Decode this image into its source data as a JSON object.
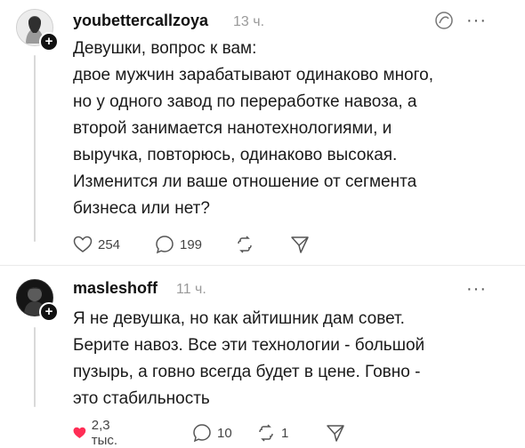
{
  "posts": [
    {
      "username": "youbettercallzoya",
      "time": "13 ч.",
      "text": "Девушки, вопрос к вам:\nдвое мужчин зарабатывают одинаково много,\nно у одного завод по переработке навоза, а\nвторой занимается нанотехнологиями, и\nвыручка, повторюсь, одинаково высокая.\nИзменится ли ваше отношение от сегмента\nбизнеса или нет?",
      "likes": "254",
      "replies": "199",
      "reposts": "",
      "liked": false
    },
    {
      "username": "masleshoff",
      "time": "11 ч.",
      "text": "Я не девушка, но как айтишник дам совет.\nБерите навоз. Все эти технологии - большой\nпузырь, а говно всегда будет в цене. Говно -\nэто стабильность",
      "likes": "2,3 тыс.",
      "replies": "10",
      "reposts": "1",
      "liked": true
    }
  ],
  "colors": {
    "like_active": "#ff2d55",
    "muted": "#9a9a9a",
    "text": "#1a1a1a"
  },
  "icons": {
    "like": "heart-icon",
    "reply": "comment-icon",
    "repost": "repost-icon",
    "share": "send-icon",
    "menu": "more-icon",
    "thread_status": "spiral-icon",
    "follow": "plus-icon"
  }
}
